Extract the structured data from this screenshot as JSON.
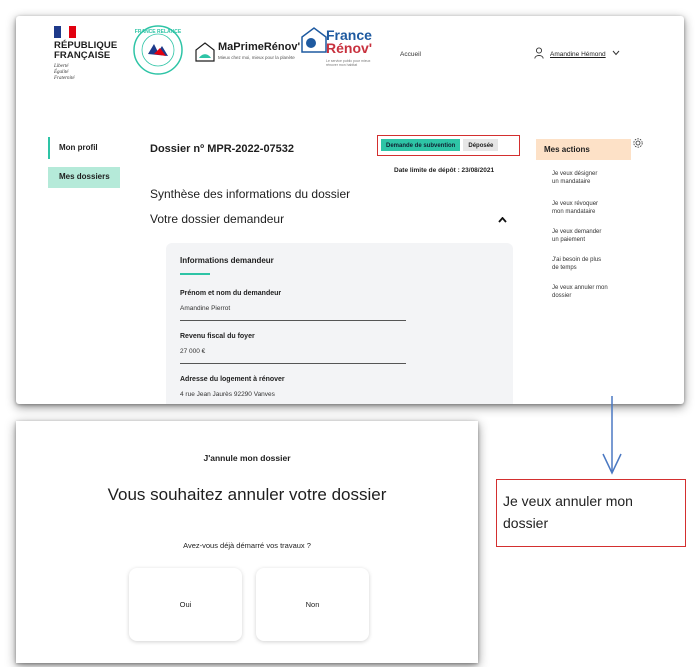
{
  "header": {
    "republique": [
      "RÉPUBLIQUE",
      "FRANÇAISE"
    ],
    "motto": [
      "Liberté",
      "Égalité",
      "Fraternité"
    ],
    "relance_ring": "FRANCE RELANCE",
    "maprimerenov": "MaPrimeRénov'",
    "maprimerenov_tagline": "Mieux chez moi, mieux pour la planète",
    "france_renov": [
      "France",
      "Rénov'"
    ],
    "france_renov_tagline": "Le service public pour mieux rénover mon habitat",
    "nav_accueil": "Accueil",
    "user_name": "Amandine Hémond"
  },
  "sidebar": {
    "items": [
      {
        "label": "Mon profil"
      },
      {
        "label": "Mes dossiers"
      }
    ]
  },
  "dossier": {
    "title": "Dossier nº MPR-2022-07532",
    "badge_type": "Demande de subvention",
    "badge_status": "Déposée",
    "deadline": "Date limite de dépôt : 23/08/2021",
    "synthese": "Synthèse des informations du dossier",
    "section": "Votre dossier demandeur",
    "panel": {
      "heading": "Informations demandeur",
      "fields": [
        {
          "label": "Prénom et nom du demandeur",
          "value": "Amandine Pierrot"
        },
        {
          "label": "Revenu fiscal du foyer",
          "value": "27 000 €"
        },
        {
          "label": "Adresse du logement à rénover",
          "value": "4 rue Jean Jaurès 92290 Vanves"
        }
      ]
    }
  },
  "actions": {
    "heading": "Mes actions",
    "items": [
      [
        "Je veux désigner",
        "un mandataire"
      ],
      [
        "Je veux révoquer",
        "mon mandataire"
      ],
      [
        "Je veux demander",
        "un paiement"
      ],
      [
        "J'ai besoin de plus",
        "de temps"
      ],
      [
        "Je veux annuler mon",
        "dossier"
      ]
    ]
  },
  "modal": {
    "title": "J'annule mon dossier",
    "question": "Vous souhaitez annuler votre dossier",
    "subquestion": "Avez-vous déjà démarré vos travaux ?",
    "yes": "Oui",
    "no": "Non"
  },
  "callout": [
    "Je veux annuler mon",
    "dossier"
  ],
  "colors": {
    "accent_green": "#2ec4a6",
    "nav_active_bg": "#b5ead9",
    "actions_bg": "#fde1c7",
    "highlight_red": "#d32f2f",
    "arrow_blue": "#4a78c2",
    "france_blue": "#1e5aa0",
    "france_red": "#c8313e"
  }
}
